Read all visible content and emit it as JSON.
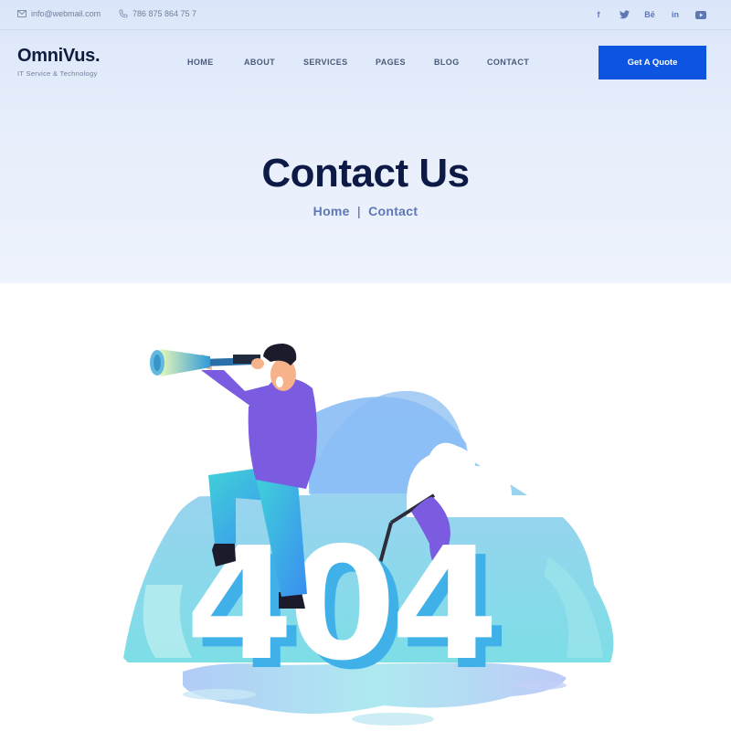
{
  "topbar": {
    "email": "info@webmail.com",
    "phone": "786 875 864 75 7",
    "socials": [
      {
        "icon": "facebook-icon",
        "glyph": "f"
      },
      {
        "icon": "twitter-icon",
        "glyph": "t"
      },
      {
        "icon": "behance-icon",
        "glyph": "Bē"
      },
      {
        "icon": "linkedin-icon",
        "glyph": "in"
      },
      {
        "icon": "youtube-icon",
        "glyph": "▶"
      }
    ]
  },
  "logo": {
    "brand": "OmniVus.",
    "tagline": "IT Service & Technology"
  },
  "nav": {
    "items": [
      {
        "label": "HOME"
      },
      {
        "label": "ABOUT"
      },
      {
        "label": "SERVICES"
      },
      {
        "label": "PAGES"
      },
      {
        "label": "BLOG"
      },
      {
        "label": "CONTACT"
      }
    ]
  },
  "cta": {
    "label": "Get A Quote"
  },
  "page": {
    "title": "Contact Us",
    "breadcrumb_home": "Home",
    "breadcrumb_separator": "|",
    "breadcrumb_current": "Contact"
  },
  "illustration": {
    "text": "404"
  },
  "colors": {
    "accent": "#0d55e1",
    "heading": "#0d1a45",
    "link": "#5d78b4"
  }
}
